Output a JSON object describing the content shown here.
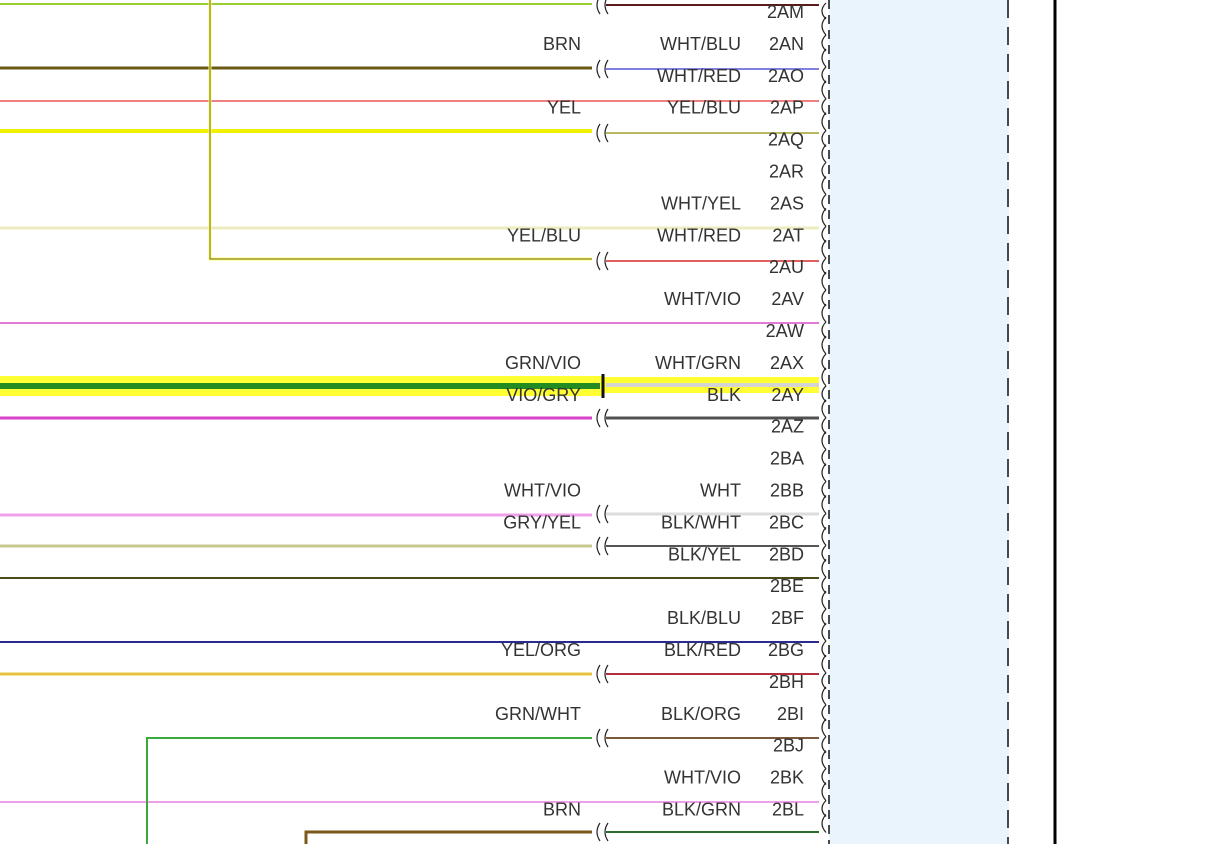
{
  "diagram": {
    "pins": [
      {
        "pin": "2AM",
        "wire_color": "",
        "mate_color": ""
      },
      {
        "pin": "2AN",
        "wire_color": "WHT/BLU",
        "mate_color": "BRN"
      },
      {
        "pin": "2AO",
        "wire_color": "WHT/RED",
        "mate_color": ""
      },
      {
        "pin": "2AP",
        "wire_color": "YEL/BLU",
        "mate_color": "YEL"
      },
      {
        "pin": "2AQ",
        "wire_color": "",
        "mate_color": ""
      },
      {
        "pin": "2AR",
        "wire_color": "",
        "mate_color": ""
      },
      {
        "pin": "2AS",
        "wire_color": "WHT/YEL",
        "mate_color": ""
      },
      {
        "pin": "2AT",
        "wire_color": "WHT/RED",
        "mate_color": "YEL/BLU"
      },
      {
        "pin": "2AU",
        "wire_color": "",
        "mate_color": ""
      },
      {
        "pin": "2AV",
        "wire_color": "WHT/VIO",
        "mate_color": ""
      },
      {
        "pin": "2AW",
        "wire_color": "",
        "mate_color": ""
      },
      {
        "pin": "2AX",
        "wire_color": "WHT/GRN",
        "mate_color": "GRN/VIO"
      },
      {
        "pin": "2AY",
        "wire_color": "BLK",
        "mate_color": "VIO/GRY"
      },
      {
        "pin": "2AZ",
        "wire_color": "",
        "mate_color": ""
      },
      {
        "pin": "2BA",
        "wire_color": "",
        "mate_color": ""
      },
      {
        "pin": "2BB",
        "wire_color": "WHT",
        "mate_color": "WHT/VIO"
      },
      {
        "pin": "2BC",
        "wire_color": "BLK/WHT",
        "mate_color": "GRY/YEL"
      },
      {
        "pin": "2BD",
        "wire_color": "BLK/YEL",
        "mate_color": ""
      },
      {
        "pin": "2BE",
        "wire_color": "",
        "mate_color": ""
      },
      {
        "pin": "2BF",
        "wire_color": "BLK/BLU",
        "mate_color": ""
      },
      {
        "pin": "2BG",
        "wire_color": "BLK/RED",
        "mate_color": "YEL/ORG"
      },
      {
        "pin": "2BH",
        "wire_color": "",
        "mate_color": ""
      },
      {
        "pin": "2BI",
        "wire_color": "BLK/ORG",
        "mate_color": "GRN/WHT"
      },
      {
        "pin": "2BJ",
        "wire_color": "",
        "mate_color": ""
      },
      {
        "pin": "2BK",
        "wire_color": "WHT/VIO",
        "mate_color": ""
      },
      {
        "pin": "2BL",
        "wire_color": "BLK/GRN",
        "mate_color": "BRN"
      }
    ],
    "highlight_color": "#ffff33",
    "connector_fill": "#eaf4fc"
  }
}
